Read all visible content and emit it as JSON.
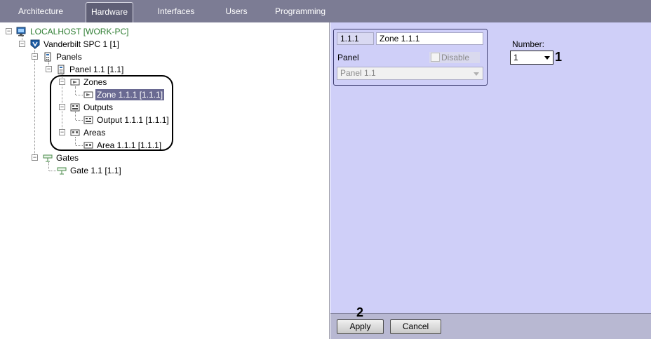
{
  "tabs": [
    {
      "label": "Architecture"
    },
    {
      "label": "Hardware",
      "active": true
    },
    {
      "label": "Interfaces"
    },
    {
      "label": "Users"
    },
    {
      "label": "Programming"
    }
  ],
  "tree": {
    "root": "LOCALHOST [WORK-PC]",
    "device": "Vanderbilt SPC 1 [1]",
    "panels": "Panels",
    "panel": "Panel 1.1 [1.1]",
    "zones": "Zones",
    "zone": "Zone 1.1.1 [1.1.1]",
    "outputs": "Outputs",
    "output": "Output 1.1.1 [1.1.1]",
    "areas": "Areas",
    "area": "Area 1.1.1 [1.1.1]",
    "gates": "Gates",
    "gate": "Gate 1.1 [1.1]"
  },
  "properties": {
    "id": "1.1.1",
    "name": "Zone 1.1.1",
    "panel_label": "Panel",
    "disable_label": "Disable",
    "panel_value": "Panel 1.1",
    "number_label": "Number:",
    "number_value": "1"
  },
  "annotations": {
    "one": "1",
    "two": "2"
  },
  "buttons": {
    "apply": "Apply",
    "cancel": "Cancel"
  },
  "colors": {
    "tabbar": "#7c7c94",
    "panel_bg": "#cfcff8",
    "selection": "#6a6a92",
    "root_text": "#2e7d32"
  },
  "icons": [
    "computer-icon",
    "vanderbilt-device-icon",
    "panels-icon",
    "panel-icon",
    "zones-icon",
    "zone-icon",
    "outputs-icon",
    "output-icon",
    "areas-icon",
    "area-icon",
    "gates-icon",
    "gate-icon"
  ]
}
